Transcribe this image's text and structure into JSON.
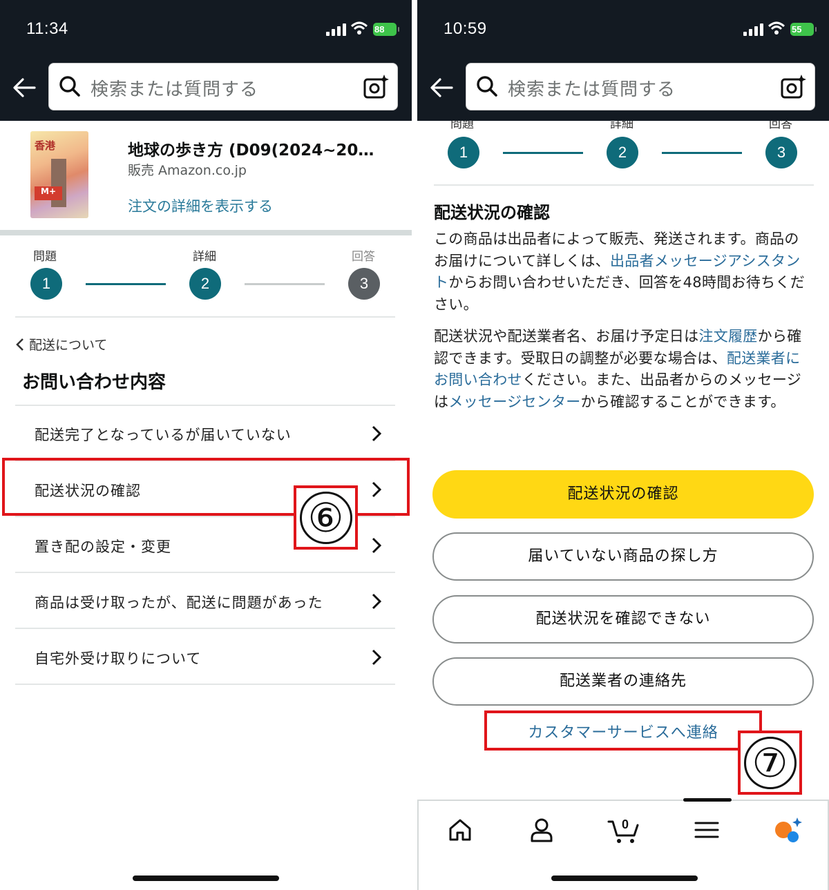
{
  "left": {
    "status": {
      "time": "11:34",
      "battery": "88"
    },
    "search": {
      "placeholder": "検索または質問する"
    },
    "product": {
      "title": "地球の歩き方 (D09(2024~20…",
      "seller": "販売 Amazon.co.jp",
      "order_link": "注文の詳細を表示する",
      "image_text": "香港"
    },
    "steps": [
      {
        "label": "問題",
        "num": "1"
      },
      {
        "label": "詳細",
        "num": "2"
      },
      {
        "label": "回答",
        "num": "3"
      }
    ],
    "breadcrumb": "配送について",
    "heading": "お問い合わせ内容",
    "menu": [
      "配送完了となっているが届いていない",
      "配送状況の確認",
      "置き配の設定・変更",
      "商品は受け取ったが、配送に問題があった",
      "自宅外受け取りについて"
    ],
    "annotation": "⑥"
  },
  "right": {
    "status": {
      "time": "10:59",
      "battery": "55"
    },
    "search": {
      "placeholder": "検索または質問する"
    },
    "steps": [
      {
        "label": "問題",
        "num": "1"
      },
      {
        "label": "詳細",
        "num": "2"
      },
      {
        "label": "回答",
        "num": "3"
      }
    ],
    "heading": "配送状況の確認",
    "para1": {
      "t1": "この商品は出品者によって販売、発送されます。商品のお届けについて詳しくは、",
      "link1": "出品者メッセージアシスタント",
      "t2": "からお問い合わせいただき、回答を48時間お待ちください。"
    },
    "para2": {
      "t1": "配送状況や配送業者名、お届け予定日は",
      "link1": "注文履歴",
      "t2": "から確認できます。受取日の調整が必要な場合は、",
      "link2": "配送業者にお問い合わせ",
      "t3": "ください。また、出品者からのメッセージは",
      "link3": "メッセージセンター",
      "t4": "から確認することができます。"
    },
    "buttons": {
      "primary": "配送状況の確認",
      "b1": "届いていない商品の探し方",
      "b2": "配送状況を確認できない",
      "b3": "配送業者の連絡先"
    },
    "cs_link": "カスタマーサービスへ連絡",
    "cart_count": "0",
    "annotation": "⑦"
  },
  "colors": {
    "accent_teal": "#0f6b7a",
    "inactive_step": "#5a5f63",
    "link": "#2a6c9a",
    "primary_button": "#ffd814",
    "highlight_red": "#e0151a"
  }
}
